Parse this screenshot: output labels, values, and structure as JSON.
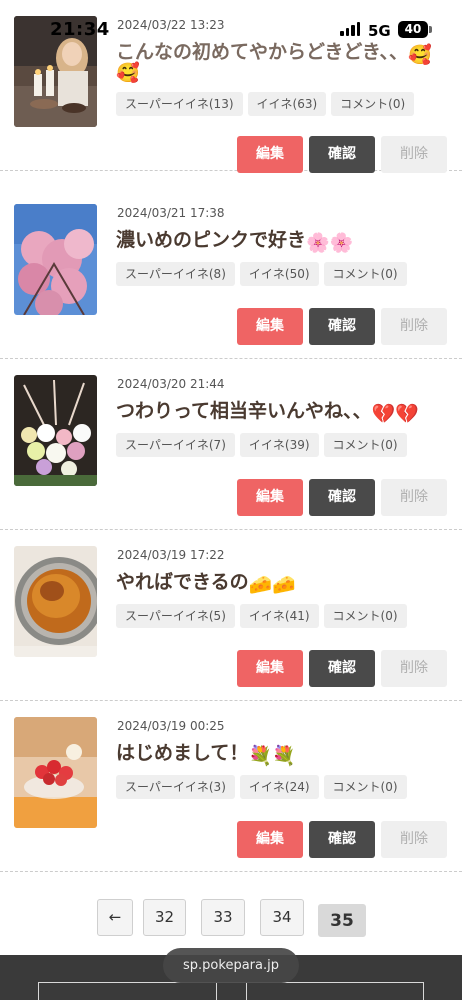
{
  "status_bar": {
    "time": "21:34",
    "network": "5G",
    "battery": "40"
  },
  "posts": [
    {
      "date": "2024/03/22 13:23",
      "title": "こんなの初めてやからどきどき、、",
      "title_emoji": [
        "🥰",
        "🥰"
      ],
      "tags": [
        "スーパーイイネ(13)",
        "イイネ(63)",
        "コメント(0)"
      ],
      "image": "woman-with-candles-photo"
    },
    {
      "date": "2024/03/21 17:38",
      "title": "濃いめのピンクで好き",
      "title_emoji": [
        "🌸",
        "🌸"
      ],
      "tags": [
        "スーパーイイネ(8)",
        "イイネ(50)",
        "コメント(0)"
      ],
      "image": "cherry-blossom-photo"
    },
    {
      "date": "2024/03/20 21:44",
      "title": "つわりって相当辛いんやね、、",
      "title_emoji": [
        "💔",
        "💔"
      ],
      "tags": [
        "スーパーイイネ(7)",
        "イイネ(39)",
        "コメント(0)"
      ],
      "image": "flower-arrangement-photo"
    },
    {
      "date": "2024/03/19 17:22",
      "title": "やればできるの",
      "title_emoji": [
        "🧀",
        "🧀"
      ],
      "tags": [
        "スーパーイイネ(5)",
        "イイネ(41)",
        "コメント(0)"
      ],
      "image": "cheesecake-photo"
    },
    {
      "date": "2024/03/19 00:25",
      "title": "はじめまして！",
      "title_emoji": [
        "💐",
        "💐"
      ],
      "tags": [
        "スーパーイイネ(3)",
        "イイネ(24)",
        "コメント(0)"
      ],
      "image": "strawberry-dessert-photo"
    }
  ],
  "actions": {
    "edit_label": "編集",
    "confirm_label": "確認",
    "delete_label": "削除"
  },
  "pagination": {
    "prev_label": "←",
    "pages": [
      "32",
      "33",
      "34",
      "35"
    ],
    "current": "35"
  },
  "browser": {
    "url": "sp.pokepara.jp"
  },
  "colors": {
    "edit": "#ef6464",
    "confirm": "#4a4a4a",
    "delete": "#efefef",
    "footer": "#3a3a3a"
  }
}
